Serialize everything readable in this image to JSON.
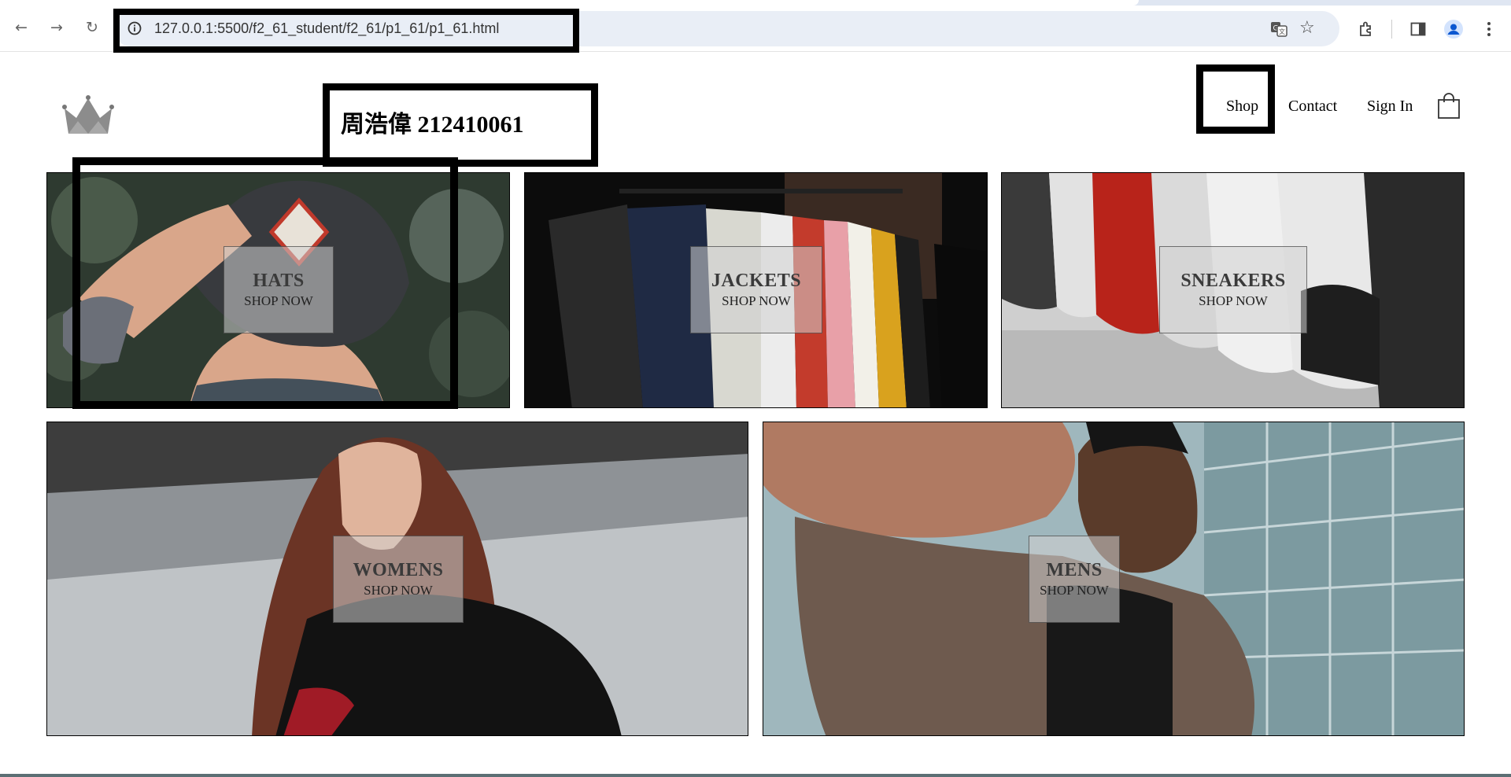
{
  "browser": {
    "url": "127.0.0.1:5500/f2_61_student/f2_61/p1_61/p1_61.html",
    "icons": [
      "back-icon",
      "forward-icon",
      "reload-icon",
      "info-icon",
      "translate-icon",
      "star-icon",
      "extensions-icon",
      "sidepanel-icon",
      "profile-icon",
      "menu-icon"
    ]
  },
  "header": {
    "student": "周浩偉 212410061",
    "nav": [
      "Shop",
      "Contact",
      "Sign In"
    ],
    "icons": [
      "crown-logo-icon",
      "shopping-bag-icon"
    ]
  },
  "tiles": [
    {
      "title": "HATS",
      "subtitle": "SHOP NOW"
    },
    {
      "title": "JACKETS",
      "subtitle": "SHOP NOW"
    },
    {
      "title": "SNEAKERS",
      "subtitle": "SHOP NOW"
    },
    {
      "title": "WOMENS",
      "subtitle": "SHOP NOW"
    },
    {
      "title": "MENS",
      "subtitle": "SHOP NOW"
    }
  ],
  "colors": {
    "omnibox": "#e9eef6",
    "tile_label_bg": "rgba(210,210,210,0.55)",
    "annotation": "#000000"
  }
}
